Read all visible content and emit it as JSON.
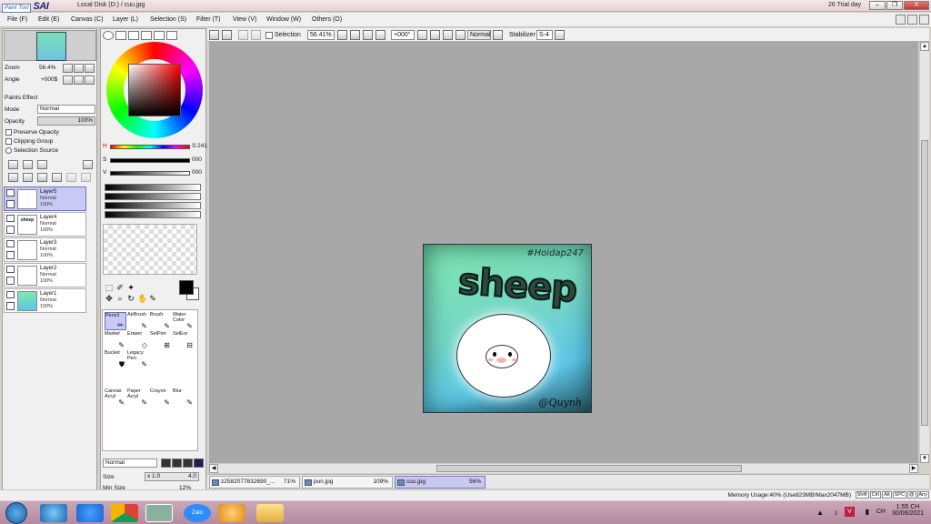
{
  "app": {
    "logo_prefix": "Paint Tool",
    "logo_name": "SAI",
    "document_title": "Local Disk (D:) / cuu.jpg",
    "trial_text": "26 Trial day",
    "window_buttons": [
      "–",
      "❐",
      "X"
    ]
  },
  "menu": [
    "File (F)",
    "Edit (E)",
    "Canvas (C)",
    "Layer (L)",
    "Selection (S)",
    "Filter (T)",
    "View (V)",
    "Window (W)",
    "Others (O)"
  ],
  "navigator": {
    "zoom_label": "Zoom",
    "zoom_value": "56.4%",
    "angle_label": "Angle",
    "angle_value": "+000$"
  },
  "layer_props": {
    "paint_effect": "Paints Effect",
    "mode_label": "Mode",
    "mode_value": "Normal",
    "opacity_label": "Opacity",
    "opacity_value": "100%",
    "checks": [
      "Preserve Opacity",
      "Clipping Group",
      "Selection Source"
    ]
  },
  "layers": [
    {
      "name": "Layer5",
      "mode": "Normal",
      "opacity": "100%",
      "selected": true
    },
    {
      "name": "Layer4",
      "mode": "Normal",
      "opacity": "100%",
      "selected": false,
      "thumb_text": "sheep"
    },
    {
      "name": "Layer3",
      "mode": "Normal",
      "opacity": "100%",
      "selected": false
    },
    {
      "name": "Layer2",
      "mode": "Normal",
      "opacity": "100%",
      "selected": false
    },
    {
      "name": "Layer1",
      "mode": "Normal",
      "opacity": "100%",
      "selected": false
    }
  ],
  "color": {
    "h_label": "H",
    "h_value": "S:241",
    "s_label": "S",
    "s_value": "000",
    "v_label": "V",
    "v_value": "000",
    "fg": "#000000",
    "bg": "#ffffff"
  },
  "brush": {
    "tools": [
      {
        "name": "Pencil",
        "selected": true
      },
      {
        "name": "AirBrush",
        "selected": false
      },
      {
        "name": "Brush",
        "selected": false
      },
      {
        "name": "Water Color",
        "selected": false
      },
      {
        "name": "Marker",
        "selected": false
      },
      {
        "name": "Eraser",
        "selected": false
      },
      {
        "name": "SelPen",
        "selected": false
      },
      {
        "name": "SelErs",
        "selected": false
      },
      {
        "name": "Bucket",
        "selected": false
      },
      {
        "name": "Legacy Pen",
        "selected": false
      },
      {
        "name": "Canvas Acryl",
        "selected": false
      },
      {
        "name": "Paper Acryl",
        "selected": false
      },
      {
        "name": "Crayon",
        "selected": false
      },
      {
        "name": "Blur",
        "selected": false
      }
    ],
    "blend_mode": "Normal",
    "size_label": "Size",
    "size_mult": "x 1.0",
    "size_value": "4.0",
    "min_size_label": "Min Size",
    "min_size_value": "12%"
  },
  "canvas_toolbar": {
    "selection_label": "Selection",
    "zoom_value": "56.41%",
    "angle_value": "+000°",
    "blend": "Normal",
    "stabilizer_label": "Stabilizer",
    "stabilizer_value": "S-4"
  },
  "artwork": {
    "hashtag": "#Hoidap247",
    "title": "sheep",
    "signature": "@Quynh"
  },
  "doc_tabs": [
    {
      "name": "z2582077832690_...",
      "zoom": "71%",
      "active": false
    },
    {
      "name": "pun.jpg",
      "zoom": "109%",
      "active": false
    },
    {
      "name": "cuu.jpg",
      "zoom": "56%",
      "active": true
    }
  ],
  "status": {
    "memory": "Memory Usage:40% (Use823MB/Max2047MB)",
    "keys": [
      "Shift",
      "Ctrl",
      "Alt",
      "SPC",
      "@",
      "Any"
    ]
  },
  "taskbar": {
    "apps": [
      "internet-explorer-icon",
      "zoom-icon",
      "chrome-icon",
      "paint-tool-sai-icon",
      "zalo-icon",
      "paint-icon",
      "file-explorer-icon"
    ],
    "zalo_label": "Zalo",
    "lang": "CH",
    "time": "1:55 CH",
    "date": "30/06/2021"
  }
}
